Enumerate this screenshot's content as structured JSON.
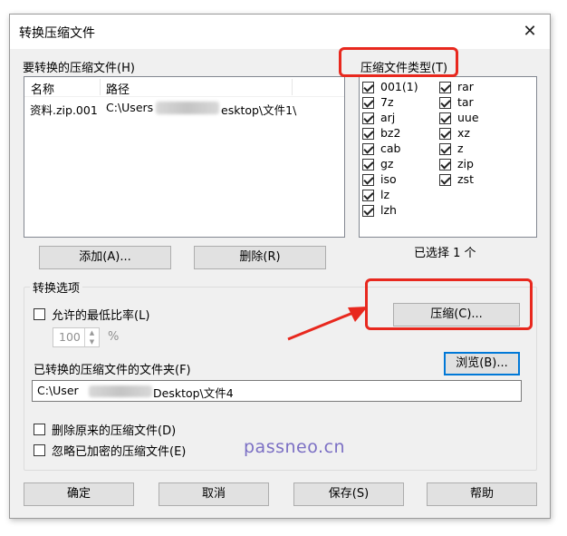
{
  "window": {
    "title": "转换压缩文件",
    "close": "✕"
  },
  "archives": {
    "label": "要转换的压缩文件(H)",
    "columns": [
      "名称",
      "路径"
    ],
    "rows": [
      {
        "name": "资料.zip.001",
        "path_start": "C:\\Users",
        "path_end": "esktop\\文件1\\"
      }
    ],
    "add_button": "添加(A)...",
    "delete_button": "删除(R)"
  },
  "types": {
    "label": "压缩文件类型(T)",
    "items": [
      {
        "name": "001(1)",
        "checked": true
      },
      {
        "name": "7z",
        "checked": true
      },
      {
        "name": "arj",
        "checked": true
      },
      {
        "name": "bz2",
        "checked": true
      },
      {
        "name": "cab",
        "checked": true
      },
      {
        "name": "gz",
        "checked": true
      },
      {
        "name": "iso",
        "checked": true
      },
      {
        "name": "lz",
        "checked": true
      },
      {
        "name": "lzh",
        "checked": true
      },
      {
        "name": "rar",
        "checked": true
      },
      {
        "name": "tar",
        "checked": true
      },
      {
        "name": "uue",
        "checked": true
      },
      {
        "name": "xz",
        "checked": true
      },
      {
        "name": "z",
        "checked": true
      },
      {
        "name": "zip",
        "checked": true
      },
      {
        "name": "zst",
        "checked": true
      }
    ],
    "selected_count": "已选择 1 个"
  },
  "options": {
    "group_label": "转换选项",
    "min_ratio_label": "允许的最低比率(L)",
    "min_ratio_checked": false,
    "ratio_value": "100",
    "ratio_unit": "%",
    "compress_button": "压缩(C)...",
    "folder_label": "已转换的压缩文件的文件夹(F)",
    "browse_button": "浏览(B)...",
    "folder_start": "C:\\User",
    "folder_end": "Desktop\\文件4",
    "delete_original_label": "删除原来的压缩文件(D)",
    "delete_original_checked": false,
    "skip_encrypted_label": "忽略已加密的压缩文件(E)",
    "skip_encrypted_checked": false
  },
  "footer": {
    "ok": "确定",
    "cancel": "取消",
    "save": "保存(S)",
    "help": "帮助"
  },
  "watermark": "passneo.cn",
  "colors": {
    "highlight": "#e8281e",
    "focus": "#0078d7",
    "watermark": "#7b6fc4"
  }
}
